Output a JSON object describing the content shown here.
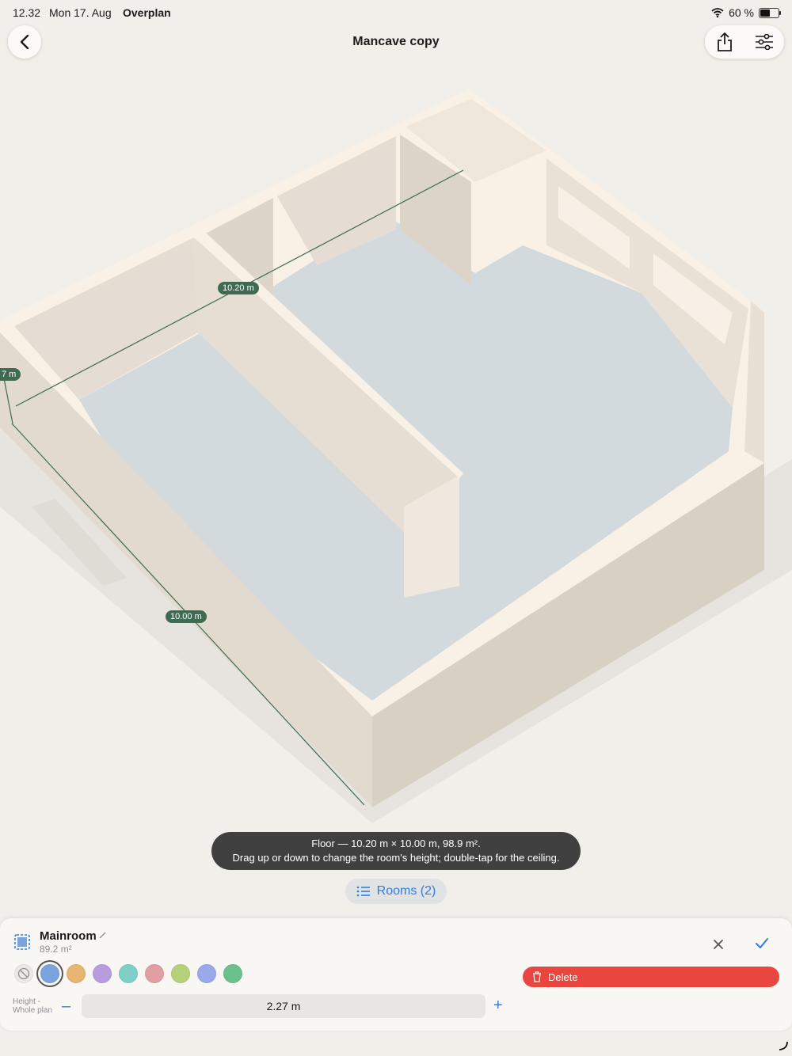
{
  "status": {
    "time": "12.32",
    "date": "Mon 17. Aug",
    "app": "Overplan",
    "battery": "60 %",
    "battery_level": 0.6
  },
  "nav": {
    "title": "Mancave copy",
    "back_icon": "chevron-left-icon",
    "share_icon": "share-icon",
    "settings_icon": "sliders-icon"
  },
  "scene": {
    "dimensions": [
      "10.20 m",
      "10.00 m",
      "7 m"
    ],
    "colors": {
      "wall": "#ece5dc",
      "wall_top": "#faf1e6",
      "floor": "#d3dadd",
      "measure": "#3e6b52"
    }
  },
  "tooltip": {
    "line1": "Floor — 10.20 m × 10.00 m, 98.9 m².",
    "line2": "Drag up or down to change the room's height; double-tap for the ceiling."
  },
  "rooms_button": {
    "label": "Rooms (2)",
    "icon": "list-icon"
  },
  "panel": {
    "room_name": "Mainroom",
    "room_area": "89.2 m²",
    "swatches": [
      "#7ba3de",
      "#e8b572",
      "#b99be0",
      "#7fcfc9",
      "#e0a0a3",
      "#b5d17a",
      "#9aa8ec",
      "#6cc08c"
    ],
    "selected_swatch": 0,
    "delete_label": "Delete",
    "height_label_1": "Height -",
    "height_label_2": "Whole plan",
    "height_value": "2.27 m",
    "accent": "#2f7ee0",
    "danger": "#e8463f"
  }
}
